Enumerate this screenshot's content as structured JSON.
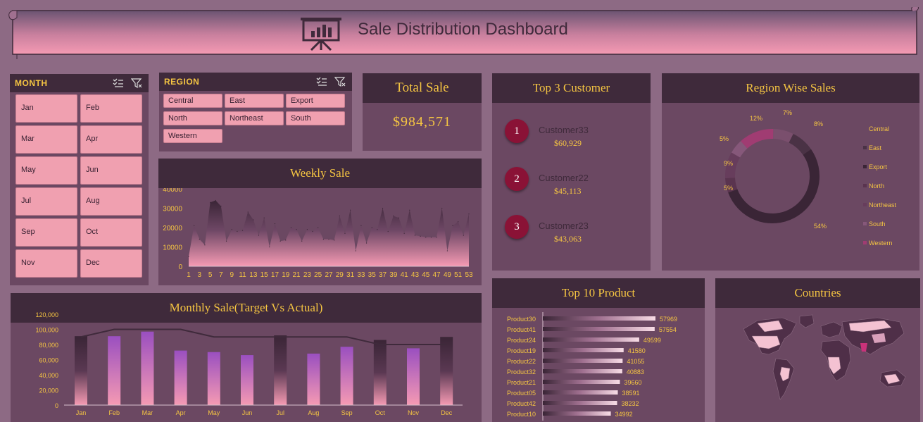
{
  "header": {
    "title": "Sale Distribution Dashboard",
    "icon": "presentation-board-icon"
  },
  "month_slicer": {
    "title": "MONTH",
    "months": [
      "Jan",
      "Feb",
      "Mar",
      "Apr",
      "May",
      "Jun",
      "Jul",
      "Aug",
      "Sep",
      "Oct",
      "Nov",
      "Dec"
    ]
  },
  "region_slicer": {
    "title": "REGION",
    "regions": [
      "Central",
      "East",
      "Export",
      "North",
      "Northeast",
      "South",
      "Western"
    ]
  },
  "total_sale": {
    "title": "Total Sale",
    "value": "$984,571"
  },
  "top_customers": {
    "title": "Top 3 Customer",
    "items": [
      {
        "rank": "1",
        "name": "Customer33",
        "amount": "$60,929"
      },
      {
        "rank": "2",
        "name": "Customer22",
        "amount": "$45,113"
      },
      {
        "rank": "3",
        "name": "Customer23",
        "amount": "$43,063"
      }
    ]
  },
  "region_wise": {
    "title": "Region Wise Sales"
  },
  "weekly": {
    "title": "Weekly Sale"
  },
  "monthly": {
    "title": "Monthly Sale(Target Vs Actual)"
  },
  "top_products": {
    "title": "Top 10 Product"
  },
  "countries": {
    "title": "Countries"
  },
  "colors": {
    "bg": "#8d6a84",
    "panel": "#6b4862",
    "header": "#3f2a3b",
    "accent": "#f5c542",
    "pink": "#f0a0b0"
  },
  "chart_data": [
    {
      "type": "area",
      "title": "Weekly Sale",
      "x": [
        1,
        2,
        3,
        4,
        5,
        6,
        7,
        8,
        9,
        10,
        11,
        12,
        13,
        14,
        15,
        16,
        17,
        18,
        19,
        20,
        21,
        22,
        23,
        24,
        25,
        26,
        27,
        28,
        29,
        30,
        31,
        32,
        33,
        34,
        35,
        36,
        37,
        38,
        39,
        40,
        41,
        42,
        43,
        44,
        45,
        46,
        47,
        48,
        49,
        50,
        51,
        52,
        53
      ],
      "values": [
        5000,
        21000,
        14000,
        11000,
        33000,
        34000,
        31000,
        13000,
        19000,
        18000,
        18500,
        28000,
        24000,
        16000,
        25000,
        10000,
        22000,
        13000,
        13500,
        20000,
        19000,
        13000,
        19000,
        18000,
        20000,
        14000,
        14000,
        13500,
        26000,
        17000,
        29000,
        8000,
        21000,
        12000,
        20000,
        19000,
        30000,
        18000,
        26000,
        25000,
        17000,
        29000,
        16000,
        15500,
        15000,
        15000,
        15000,
        30000,
        8000,
        21000,
        23000,
        16000,
        27000
      ],
      "ylim": [
        0,
        40000
      ],
      "yticks": [
        0,
        10000,
        20000,
        30000,
        40000
      ],
      "xticks": [
        1,
        3,
        5,
        7,
        9,
        11,
        13,
        15,
        17,
        19,
        21,
        23,
        25,
        27,
        29,
        31,
        33,
        35,
        37,
        39,
        41,
        43,
        45,
        47,
        49,
        51,
        53
      ]
    },
    {
      "type": "bar",
      "title": "Monthly Sale(Target Vs Actual)",
      "categories": [
        "Jan",
        "Feb",
        "Mar",
        "Apr",
        "May",
        "Jun",
        "Jul",
        "Aug",
        "Sep",
        "Oct",
        "Nov",
        "Dec"
      ],
      "series": [
        {
          "name": "Actual",
          "values": [
            91000,
            91000,
            97000,
            72000,
            70000,
            66000,
            92000,
            68000,
            77000,
            86000,
            75000,
            90000
          ]
        },
        {
          "name": "Target",
          "values": [
            90000,
            100000,
            100000,
            100000,
            90000,
            90000,
            90000,
            90000,
            90000,
            80000,
            80000,
            80000
          ]
        }
      ],
      "ylim": [
        0,
        120000
      ],
      "yticks": [
        "0",
        "20,000",
        "40,000",
        "60,000",
        "80,000",
        "100,000",
        "120,000"
      ]
    },
    {
      "type": "pie",
      "title": "Region Wise Sales",
      "labels": [
        "Central",
        "East",
        "Export",
        "North",
        "Northeast",
        "South",
        "Western"
      ],
      "values": [
        7,
        8,
        54,
        5,
        9,
        5,
        12
      ],
      "slice_labels": [
        "7%",
        "8%",
        "54%",
        "5%",
        "9%",
        "5%",
        "12%"
      ],
      "colors": [
        "#7a4f6d",
        "#4a3245",
        "#3a2536",
        "#5a344f",
        "#673d5c",
        "#86587a",
        "#a03c72"
      ],
      "legend_position": "right"
    },
    {
      "type": "bar",
      "title": "Top 10 Product",
      "categories": [
        "Product30",
        "Product41",
        "Product24",
        "Product19",
        "Product22",
        "Product32",
        "Product21",
        "Product05",
        "Product42",
        "Product10"
      ],
      "values": [
        57969,
        57554,
        49599,
        41580,
        41055,
        40883,
        39660,
        38591,
        38232,
        34992
      ]
    }
  ]
}
